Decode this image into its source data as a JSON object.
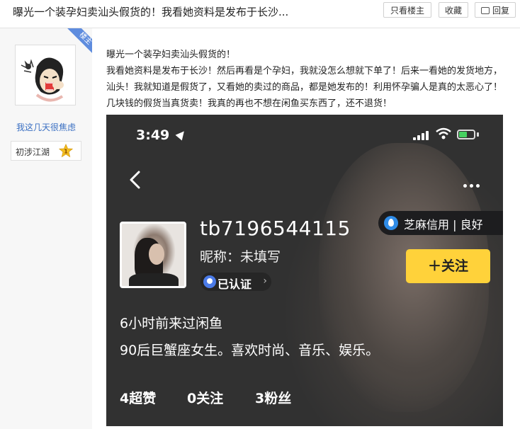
{
  "header": {
    "title": "曝光一个装孕妇卖汕头假货的！我看她资料是发布于长沙...",
    "buttons": {
      "only_op": "只看楼主",
      "favorite": "收藏",
      "reply": "回复"
    }
  },
  "author": {
    "badge": "楼主",
    "username": "我这几天很焦虑",
    "level_title": "初涉江湖",
    "level_number": "1"
  },
  "post": {
    "paragraphs": [
      "曝光一个装孕妇卖汕头假货的！",
      "我看她资料是发布于长沙！然后再看是个孕妇，我就没怎么想就下单了！后来一看她的发货地方，汕头！我就知道是假货了，又看她的卖过的商品，都是她发布的！利用怀孕骗人是真的太恶心了！几块钱的假货当真货卖！我真的再也不想在闲鱼买东西了，还不退货！"
    ]
  },
  "screenshot": {
    "status_time": "3:49",
    "battery_level": 0.55,
    "user_id": "tb7196544115",
    "nickname": "昵称：未填写",
    "verified": "已认证",
    "sesame_credit": "芝麻信用 | 良好",
    "follow_button": "＋关注",
    "last_seen": "6小时前来过闲鱼",
    "bio": "90后巨蟹座女生。喜欢时尚、音乐、娱乐。",
    "stats": {
      "likes": "4超赞",
      "following": "0关注",
      "fans": "3粉丝"
    }
  },
  "colors": {
    "follow_button": "#ffd23a",
    "badge": "#5e8cde",
    "username": "#3a6fc2",
    "battery": "#45d160"
  }
}
